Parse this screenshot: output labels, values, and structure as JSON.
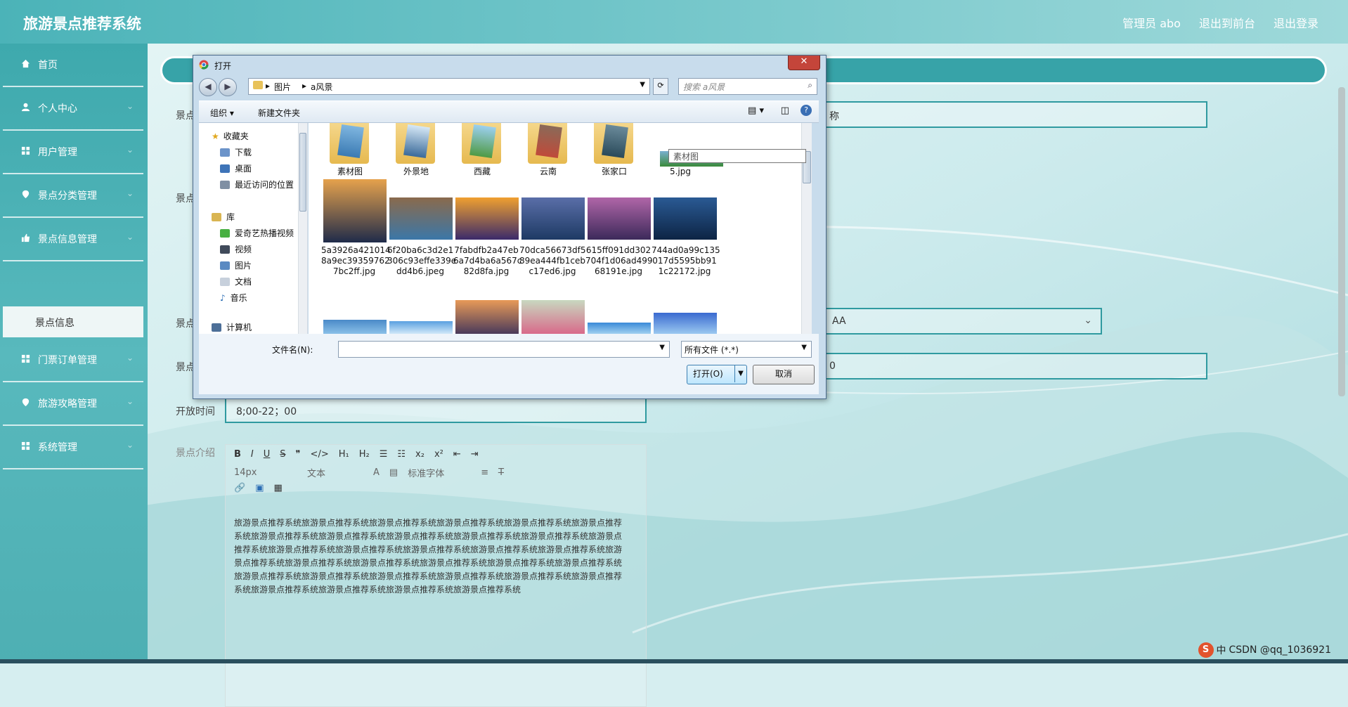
{
  "app": {
    "title": "旅游景点推荐系统"
  },
  "header": {
    "user": "管理员 abo",
    "front": "退出到前台",
    "logout": "退出登录"
  },
  "sidebar": {
    "items": [
      {
        "label": "首页",
        "icon": "home-icon"
      },
      {
        "label": "个人中心",
        "icon": "user-icon"
      },
      {
        "label": "用户管理",
        "icon": "grid-icon"
      },
      {
        "label": "景点分类管理",
        "icon": "pin-icon"
      },
      {
        "label": "景点信息管理",
        "icon": "thumb-icon"
      },
      {
        "label": "门票订单管理",
        "icon": "grid-icon"
      },
      {
        "label": "旅游攻略管理",
        "icon": "pin-icon"
      },
      {
        "label": "系统管理",
        "icon": "grid-icon"
      }
    ],
    "active_sub": "景点信息"
  },
  "form": {
    "label_1": "景点",
    "label_2": "景点",
    "label_3": "景点",
    "label_4": "景点",
    "suffix_1": "称",
    "select_value": "AA",
    "suffix_4": "0",
    "open_time_label": "开放时间",
    "open_time_value": "8;00-22；00",
    "intro_label": "景点介绍"
  },
  "editor": {
    "toolbar1": [
      "B",
      "I",
      "U",
      "S",
      "❞",
      "</>",
      "H₁",
      "H₂",
      "☰",
      "☷",
      "x₂",
      "x²",
      "⇤",
      "⇥"
    ],
    "font_size": "14px",
    "text_type": "文本",
    "font_family": "标准字体",
    "content": "旅游景点推荐系统旅游景点推荐系统旅游景点推荐系统旅游景点推荐系统旅游景点推荐系统旅游景点推荐系统旅游景点推荐系统旅游景点推荐系统旅游景点推荐系统旅游景点推荐系统旅游景点推荐系统旅游景点推荐系统旅游景点推荐系统旅游景点推荐系统旅游景点推荐系统旅游景点推荐系统旅游景点推荐系统旅游景点推荐系统旅游景点推荐系统旅游景点推荐系统旅游景点推荐系统旅游景点推荐系统旅游景点推荐系统旅游景点推荐系统旅游景点推荐系统旅游景点推荐系统旅游景点推荐系统旅游景点推荐系统旅游景点推荐系统旅游景点推荐系统旅游景点推荐系统旅游景点推荐系统旅游景点推荐系统"
  },
  "dialog": {
    "title": "打开",
    "close": "✕",
    "address": [
      "图片",
      "a风景"
    ],
    "search_placeholder": "搜索 a风景",
    "organize": "组织 ▾",
    "new_folder": "新建文件夹",
    "tree": [
      {
        "label": "收藏夹",
        "icon": "star-icon"
      },
      {
        "label": "下载",
        "icon": "download-folder-icon"
      },
      {
        "label": "桌面",
        "icon": "desktop-icon"
      },
      {
        "label": "最近访问的位置",
        "icon": "recent-icon"
      },
      {
        "label": "库",
        "icon": "library-icon"
      },
      {
        "label": "爱奇艺热播视频",
        "icon": "iqiyi-icon"
      },
      {
        "label": "视频",
        "icon": "video-icon"
      },
      {
        "label": "图片",
        "icon": "picture-icon"
      },
      {
        "label": "文档",
        "icon": "document-icon"
      },
      {
        "label": "音乐",
        "icon": "music-icon"
      },
      {
        "label": "计算机",
        "icon": "computer-icon"
      }
    ],
    "folders": [
      "素材图",
      "外景地",
      "西藏",
      "云南",
      "张家口",
      "5.jpg"
    ],
    "files": [
      {
        "name": "5a3926a4210148a9ec393597627bc2ff.jpg",
        "l1": "5a3926a421014",
        "l2": "8a9ec39359762",
        "l3": "7bc2ff.jpg",
        "c1": "#e6a24c",
        "c2": "#1f2b4a"
      },
      {
        "name": "6f20ba6c3d2e1306c93effe339edd4b6.jpeg",
        "l1": "6f20ba6c3d2e1",
        "l2": "306c93effe339e",
        "l3": "dd4b6.jpeg",
        "c1": "#8a6a4c",
        "c2": "#3b77a8"
      },
      {
        "name": "7fabdfb2a47eb6a7d4ba6a567c82d8fa.jpg",
        "l1": "7fabdfb2a47eb",
        "l2": "6a7d4ba6a567c",
        "l3": "82d8fa.jpg",
        "c1": "#f0a030",
        "c2": "#3a2a6a"
      },
      {
        "name": "70dca56673df589ea444fb1cebc17ed6.jpg",
        "l1": "70dca56673df5",
        "l2": "89ea444fb1ceb",
        "l3": "c17ed6.jpg",
        "c1": "#5a6ea8",
        "c2": "#1e3a64"
      },
      {
        "name": "615ff091dd302704f1d06ad49968191e.jpg",
        "l1": "615ff091dd302",
        "l2": "704f1d06ad499",
        "l3": "68191e.jpg",
        "c1": "#b066a8",
        "c2": "#3c2a5a"
      },
      {
        "name": "744ad0a99c135017d5595bb911c22172.jpg",
        "l1": "744ad0a99c135",
        "l2": "017d5595bb91",
        "l3": "1c22172.jpg",
        "c1": "#2a5a94",
        "c2": "#0d2444"
      }
    ],
    "tooltip": "素材图",
    "filename_label": "文件名(N):",
    "filetype": "所有文件 (*.*)",
    "open_btn": "打开(O)",
    "cancel_btn": "取消"
  },
  "ime": {
    "lang": "中",
    "text": "CSDN @qq_1036921"
  }
}
